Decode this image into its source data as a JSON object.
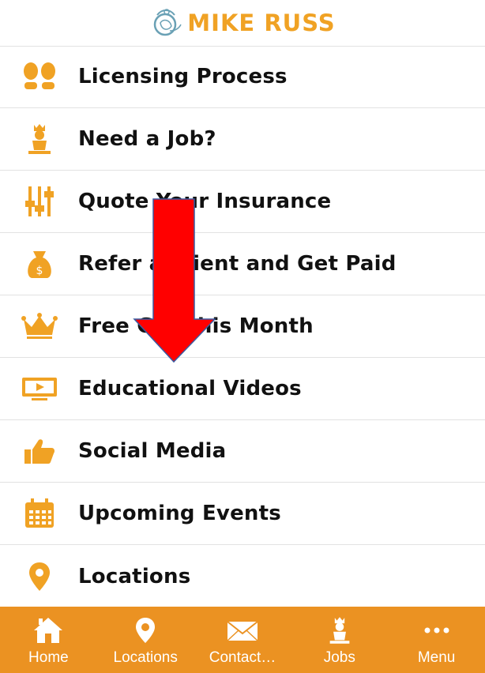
{
  "header": {
    "brand": "MIKE RUSS",
    "brand_color": "#f0a224"
  },
  "menu": {
    "items": [
      {
        "label": "Licensing Process",
        "icon": "footprints-icon"
      },
      {
        "label": "Need a Job?",
        "icon": "job-person-icon"
      },
      {
        "label": "Quote Your Insurance",
        "icon": "sliders-icon"
      },
      {
        "label": "Refer a Client and Get Paid",
        "icon": "money-bag-icon"
      },
      {
        "label": "Free Gift this Month",
        "icon": "crown-icon"
      },
      {
        "label": "Educational Videos",
        "icon": "video-play-icon"
      },
      {
        "label": "Social Media",
        "icon": "thumbs-up-icon"
      },
      {
        "label": "Upcoming Events",
        "icon": "calendar-icon"
      },
      {
        "label": "Locations",
        "icon": "map-pin-icon"
      }
    ]
  },
  "tabbar": {
    "background": "#eb9222",
    "tabs": [
      {
        "label": "Home",
        "icon": "home-icon"
      },
      {
        "label": "Locations",
        "icon": "map-pin-icon"
      },
      {
        "label": "Contact…",
        "icon": "envelope-icon"
      },
      {
        "label": "Jobs",
        "icon": "job-person-icon"
      },
      {
        "label": "Menu",
        "icon": "more-dots-icon"
      }
    ]
  },
  "overlay": {
    "arrow_color": "#ff0000",
    "icon": "down-arrow-icon"
  }
}
